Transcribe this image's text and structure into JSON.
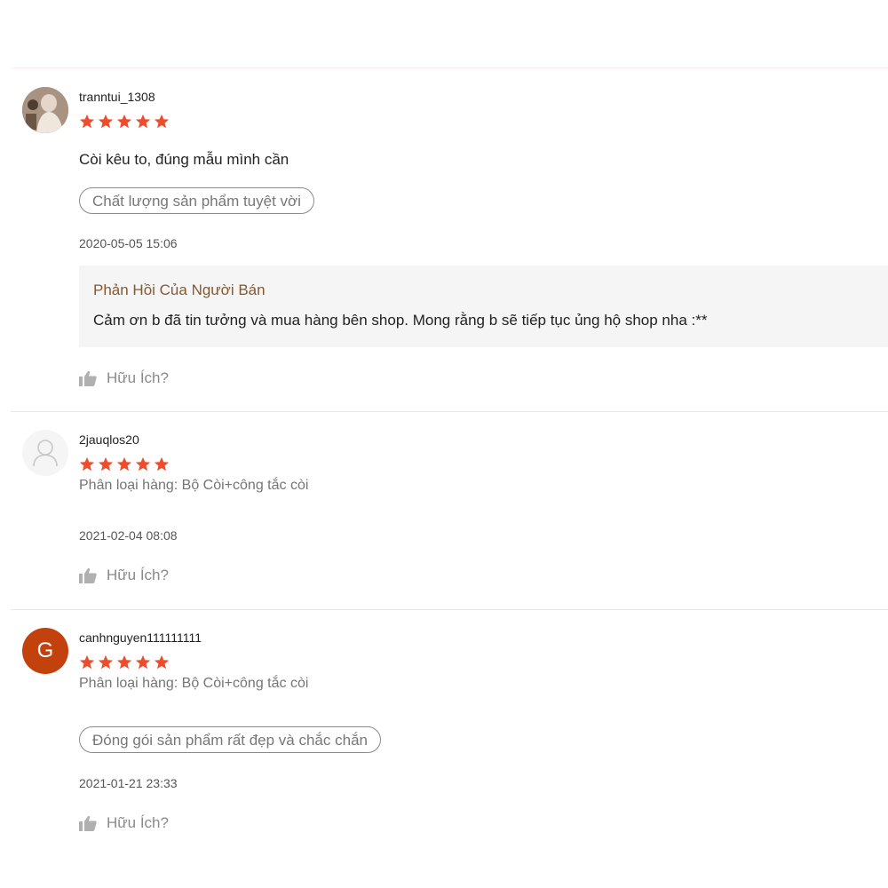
{
  "reviews": [
    {
      "username": "tranntui_1308",
      "rating": 5,
      "comment": "Còi kêu to, đúng mẫu mình cần",
      "tag": "Chất lượng sản phẩm tuyệt vời",
      "timestamp": "2020-05-05 15:06",
      "seller_reply": {
        "title": "Phản Hồi Của Người Bán",
        "text": "Cảm ơn b đã tin tưởng và mua hàng bên shop. Mong rằng b sẽ tiếp tục ủng hộ shop nha :**"
      },
      "helpful_label": "Hữu Ích?"
    },
    {
      "username": "2jauqlos20",
      "rating": 5,
      "variation": "Phân loại hàng: Bộ Còi+công tắc còi",
      "timestamp": "2021-02-04 08:08",
      "helpful_label": "Hữu Ích?"
    },
    {
      "username": "canhnguyen111111111",
      "avatar_letter": "G",
      "rating": 5,
      "variation": "Phân loại hàng: Bộ Còi+công tắc còi",
      "tag": "Đóng gói sản phẩm rất đẹp và chắc chắn",
      "timestamp": "2021-01-21 23:33",
      "helpful_label": "Hữu Ích?"
    }
  ],
  "colors": {
    "star": "#ee4d2d",
    "seller_reply_title": "#86592d",
    "avatar_letter_bg": "#c2410c"
  },
  "icons": {
    "star": "star-icon",
    "helpful": "thumbs-up-icon",
    "placeholder_avatar": "user-outline-icon"
  }
}
